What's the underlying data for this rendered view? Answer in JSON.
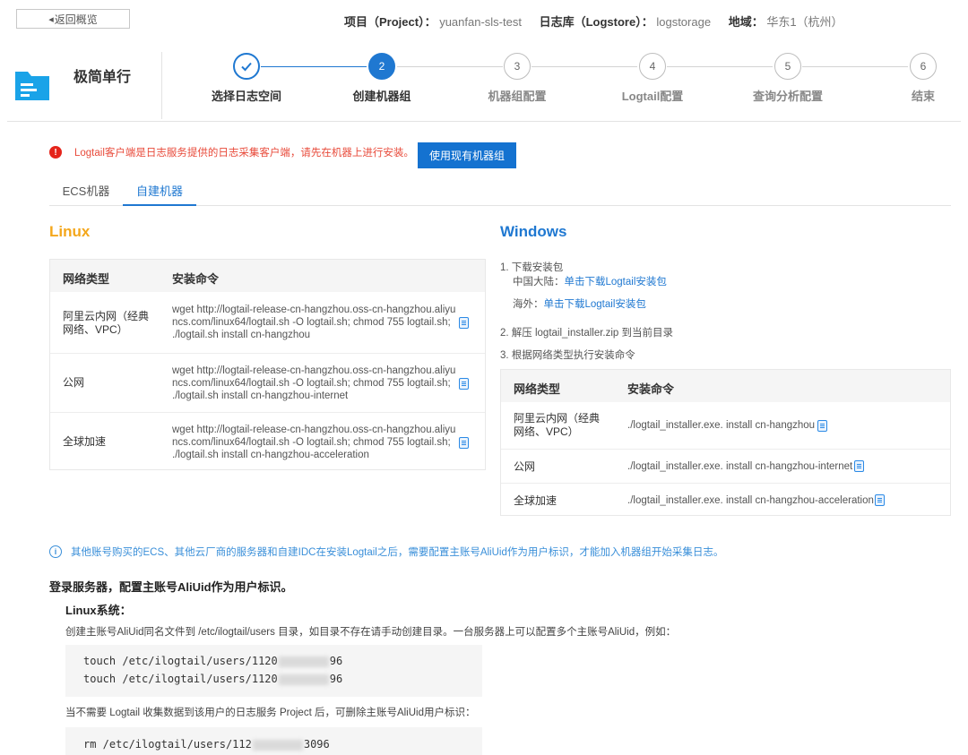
{
  "header": {
    "back_label": "返回概览",
    "project_key": "项目（Project）：",
    "project_value": "yuanfan-sls-test",
    "logstore_key": "日志库（Logstore）：",
    "logstore_value": "logstorage",
    "region_key": "地域：",
    "region_value": "华东1（杭州）"
  },
  "brand": {
    "title": "极简单行"
  },
  "steps": [
    {
      "num": "",
      "label": "选择日志空间",
      "state": "done"
    },
    {
      "num": "2",
      "label": "创建机器组",
      "state": "active"
    },
    {
      "num": "3",
      "label": "机器组配置",
      "state": "todo"
    },
    {
      "num": "4",
      "label": "Logtail配置",
      "state": "todo"
    },
    {
      "num": "5",
      "label": "查询分析配置",
      "state": "todo"
    },
    {
      "num": "6",
      "label": "结束",
      "state": "todo"
    }
  ],
  "alert": {
    "text": "Logtail客户端是日志服务提供的日志采集客户端，请先在机器上进行安装。",
    "button": "使用现有机器组"
  },
  "tabs": [
    {
      "label": "ECS机器"
    },
    {
      "label": "自建机器"
    }
  ],
  "linux": {
    "title": "Linux",
    "header": {
      "network": "网络类型",
      "command": "安装命令"
    },
    "rows": [
      {
        "network_l1": "阿里云内网（经典",
        "network_l2": "网络、VPC）",
        "cmd_l1": "wget http://logtail-release-cn-hangzhou.oss-cn-hangzhou.aliyu",
        "cmd_l2": "ncs.com/linux64/logtail.sh -O logtail.sh; chmod 755 logtail.sh;",
        "cmd_l3": "./logtail.sh install cn-hangzhou"
      },
      {
        "network_l1": "公网",
        "network_l2": "",
        "cmd_l1": "wget http://logtail-release-cn-hangzhou.oss-cn-hangzhou.aliyu",
        "cmd_l2": "ncs.com/linux64/logtail.sh -O logtail.sh; chmod 755 logtail.sh;",
        "cmd_l3": "./logtail.sh install cn-hangzhou-internet"
      },
      {
        "network_l1": "全球加速",
        "network_l2": "",
        "cmd_l1": "wget http://logtail-release-cn-hangzhou.oss-cn-hangzhou.aliyu",
        "cmd_l2": "ncs.com/linux64/logtail.sh -O logtail.sh; chmod 755 logtail.sh;",
        "cmd_l3": "./logtail.sh install cn-hangzhou-acceleration"
      }
    ]
  },
  "windows": {
    "title": "Windows",
    "step1": "1. 下载安装包",
    "china_label": "中国大陆：",
    "china_link": "单击下载Logtail安装包",
    "overseas_label": "海外：",
    "overseas_link": "单击下载Logtail安装包",
    "step2": "2. 解压 logtail_installer.zip 到当前目录",
    "step3": "3. 根据网络类型执行安装命令",
    "header": {
      "network": "网络类型",
      "command": "安装命令"
    },
    "rows": [
      {
        "network_l1": "阿里云内网（经典",
        "network_l2": "网络、VPC）",
        "cmd": "./logtail_installer.exe. install cn-hangzhou"
      },
      {
        "network_l1": "公网",
        "network_l2": "",
        "cmd": "./logtail_installer.exe. install cn-hangzhou-internet"
      },
      {
        "network_l1": "全球加速",
        "network_l2": "",
        "cmd": "./logtail_installer.exe. install cn-hangzhou-acceleration"
      }
    ]
  },
  "info_text": "其他账号购买的ECS、其他云厂商的服务器和自建IDC在安装Logtail之后，需要配置主账号AliUid作为用户标识，才能加入机器组开始采集日志。",
  "login_heading": "登录服务器，配置主账号AliUid作为用户标识。",
  "linux_heading": "Linux系统：",
  "linux_desc": "创建主账号AliUid同名文件到 /etc/ilogtail/users 目录，如目录不存在请手动创建目录。一台服务器上可以配置多个主账号AliUid，例如：",
  "code1": [
    {
      "prefix": "touch /etc/ilogtail/users/1120",
      "suffix": "96"
    },
    {
      "prefix": "touch /etc/ilogtail/users/1120",
      "suffix": "96"
    }
  ],
  "remove_desc": "当不需要 Logtail 收集数据到该用户的日志服务 Project 后，可删除主账号AliUid用户标识：",
  "code2": [
    {
      "prefix": "rm /etc/ilogtail/users/112",
      "suffix": "3096"
    }
  ]
}
